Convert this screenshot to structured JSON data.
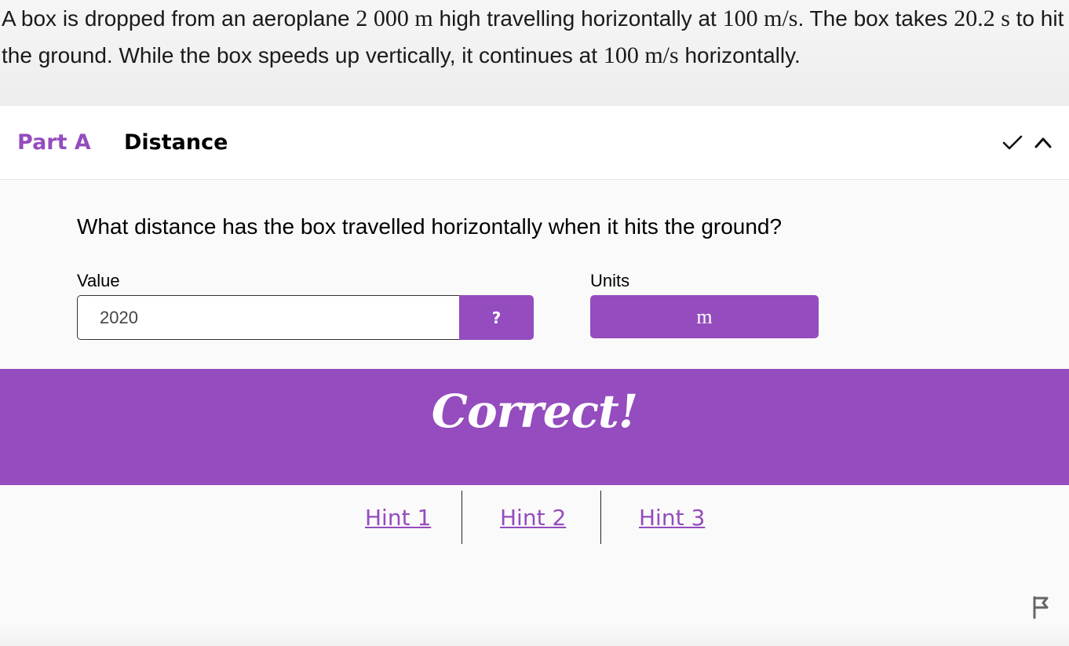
{
  "question": {
    "segments": [
      {
        "t": "A box is dropped from an aeroplane ",
        "m": false
      },
      {
        "t": "2 000 m",
        "m": true
      },
      {
        "t": " high travelling horizontally at ",
        "m": false
      },
      {
        "t": "100 m/s",
        "m": true
      },
      {
        "t": ". The box takes ",
        "m": false
      },
      {
        "t": "20.2 s",
        "m": true
      },
      {
        "t": " to hit the ground. While the box speeds up vertically, it continues at ",
        "m": false
      },
      {
        "t": "100 m/s",
        "m": true
      },
      {
        "t": " horizontally.",
        "m": false
      }
    ]
  },
  "part": {
    "label": "Part A",
    "title": "Distance",
    "prompt": "What distance has the box travelled horizontally when it hits the ground?",
    "value_label": "Value",
    "units_label": "Units",
    "value": "2020",
    "help_label": "?",
    "units_value": "m"
  },
  "feedback": {
    "text": "Correct!"
  },
  "hints": [
    "Hint 1",
    "Hint 2",
    "Hint 3"
  ],
  "colors": {
    "accent": "#944cbe",
    "text": "#000000"
  },
  "icons": {
    "status": "check-icon",
    "toggle": "chevron-up-icon",
    "report": "flag-icon"
  }
}
